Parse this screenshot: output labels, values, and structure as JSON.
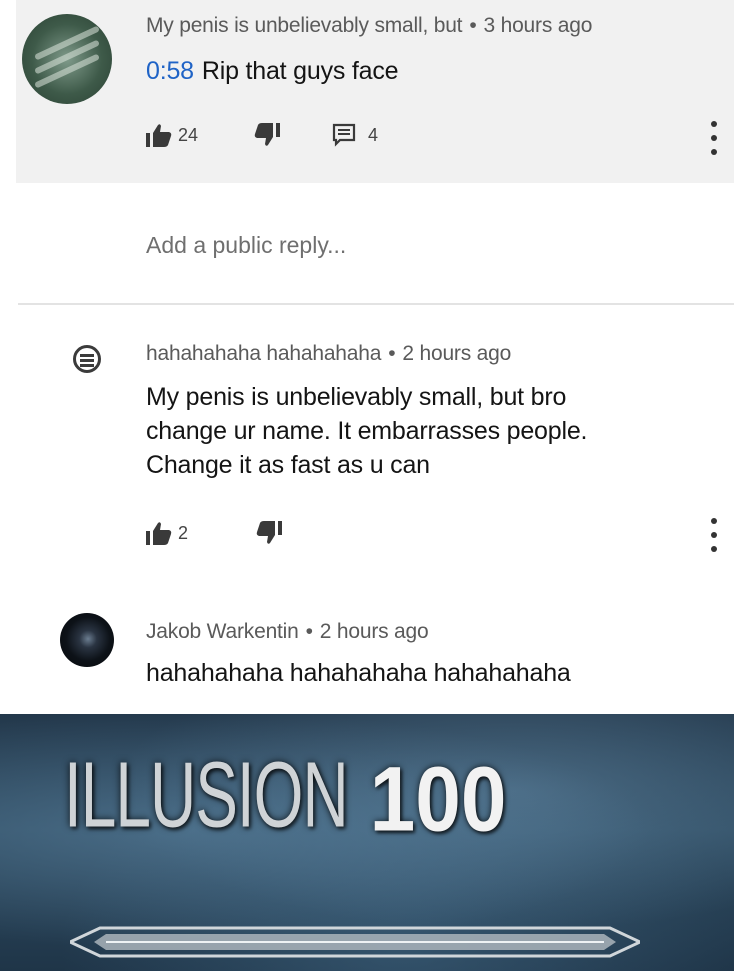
{
  "comments": [
    {
      "author": "My penis is unbelievably small, but",
      "time": "3 hours ago",
      "timestamp_link": "0:58",
      "text": "Rip that guys face",
      "likes": "24",
      "replies": "4"
    },
    {
      "author": "hahahahaha hahahahaha",
      "time": "2 hours ago",
      "text_lines": [
        "My penis is unbelievably small, but bro",
        "change ur name. It embarrasses people.",
        "Change it as fast as u can"
      ],
      "likes": "2"
    },
    {
      "author": "Jakob Warkentin",
      "time": "2 hours ago",
      "text": "hahahahaha hahahahaha hahahahaha"
    }
  ],
  "reply_placeholder": "Add a public reply...",
  "separator": "•",
  "banner": {
    "skill": "ILLUSION",
    "level": "100"
  },
  "icons": [
    "thumbs-up-icon",
    "thumbs-down-icon",
    "reply-icon",
    "more-vert-icon"
  ]
}
